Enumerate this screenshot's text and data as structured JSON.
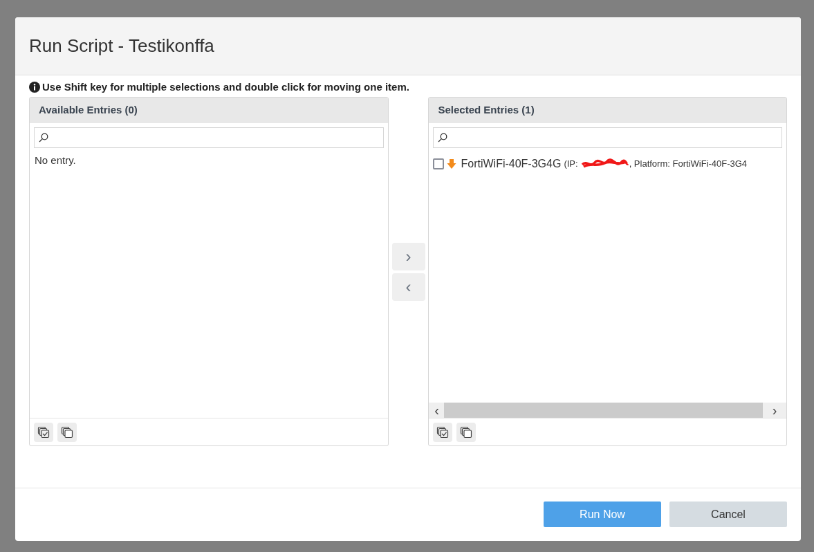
{
  "dialog": {
    "title": "Run Script - Testikonffa"
  },
  "hint": "Use Shift key for multiple selections and double click for moving one item.",
  "available": {
    "title": "Available Entries (0)",
    "empty_text": "No entry."
  },
  "selected": {
    "title": "Selected Entries (1)",
    "items": [
      {
        "name": "FortiWiFi-40F-3G4G",
        "detail_prefix": "(IP:",
        "detail_suffix": ", Platform: FortiWiFi-40F-3G4",
        "checked": false
      }
    ]
  },
  "move_buttons": [
    {
      "symbol": "›"
    },
    {
      "symbol": "‹"
    }
  ],
  "scroll_arrows": [
    "‹",
    "›"
  ],
  "buttons": [
    {
      "label": "Run Now",
      "kind": "primary"
    },
    {
      "label": "Cancel",
      "kind": "secondary"
    }
  ]
}
